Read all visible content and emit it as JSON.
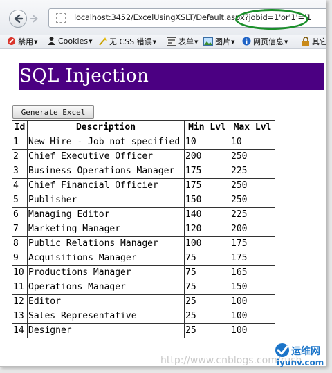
{
  "browser": {
    "url": "localhost:3452/ExcelUsingXSLT/Default.aspx?jobid=1'or'1'='1",
    "bookmarks": [
      {
        "label": "禁用",
        "icon": "no-entry-icon"
      },
      {
        "label": "Cookies",
        "icon": "user-icon"
      },
      {
        "label": "无 CSS 错误",
        "icon": "wand-icon"
      },
      {
        "label": "表单",
        "icon": "form-icon"
      },
      {
        "label": "图片",
        "icon": "image-icon"
      },
      {
        "label": "网页信息",
        "icon": "info-icon"
      },
      {
        "label": "其它",
        "icon": "lock-icon"
      }
    ]
  },
  "page": {
    "title": "SQL Injection",
    "generate_button": "Generate Excel"
  },
  "table": {
    "headers": [
      "Id",
      "Description",
      "Min Lvl",
      "Max Lvl"
    ],
    "rows": [
      [
        "1",
        "New Hire - Job not specified",
        "10",
        "10"
      ],
      [
        "2",
        "Chief Executive Officer",
        "200",
        "250"
      ],
      [
        "3",
        "Business Operations Manager",
        "175",
        "225"
      ],
      [
        "4",
        "Chief Financial Officier",
        "175",
        "250"
      ],
      [
        "5",
        "Publisher",
        "150",
        "250"
      ],
      [
        "6",
        "Managing Editor",
        "140",
        "225"
      ],
      [
        "7",
        "Marketing Manager",
        "120",
        "200"
      ],
      [
        "8",
        "Public Relations Manager",
        "100",
        "175"
      ],
      [
        "9",
        "Acquisitions Manager",
        "75",
        "175"
      ],
      [
        "10",
        "Productions Manager",
        "75",
        "165"
      ],
      [
        "11",
        "Operations Manager",
        "75",
        "150"
      ],
      [
        "12",
        "Editor",
        "25",
        "100"
      ],
      [
        "13",
        "Sales Representative",
        "25",
        "100"
      ],
      [
        "14",
        "Designer",
        "25",
        "100"
      ]
    ]
  },
  "watermark": {
    "logo_text": "运维网",
    "logo_sub": "iyunv.com",
    "url_text": "http://www.cnblogs.com/rush"
  },
  "colors": {
    "title_bg": "#4b0082",
    "highlight": "#1a8f2a"
  }
}
